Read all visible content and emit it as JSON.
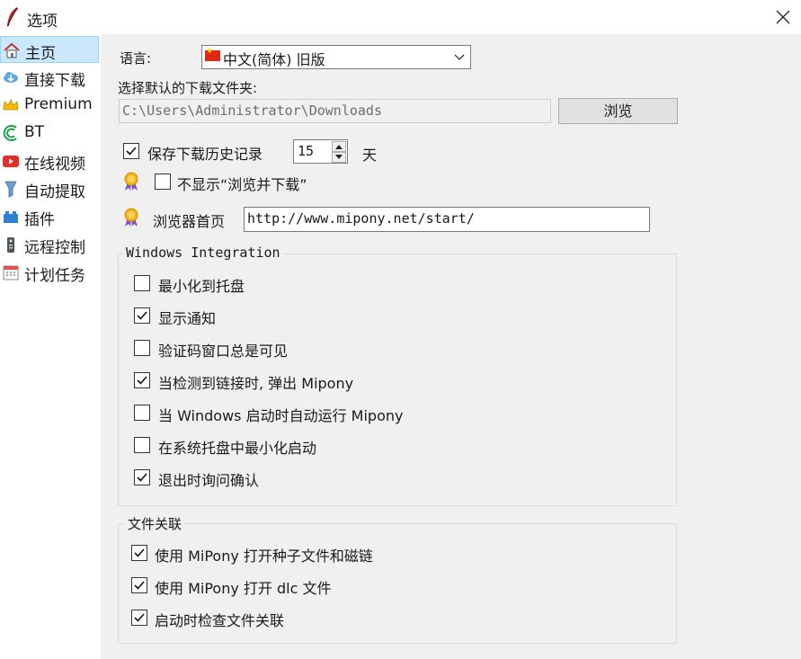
{
  "window": {
    "title": "选项"
  },
  "sidebar": {
    "items": [
      {
        "label": "主页",
        "icon": "home-icon"
      },
      {
        "label": "直接下载",
        "icon": "cloud-download-icon"
      },
      {
        "label": "Premium",
        "icon": "crown-icon"
      },
      {
        "label": "BT",
        "icon": "bittorrent-icon"
      },
      {
        "label": "在线视频",
        "icon": "youtube-icon"
      },
      {
        "label": "自动提取",
        "icon": "funnel-icon"
      },
      {
        "label": "插件",
        "icon": "plugin-icon"
      },
      {
        "label": "远程控制",
        "icon": "remote-icon"
      },
      {
        "label": "计划任务",
        "icon": "calendar-icon"
      }
    ],
    "selected": "主页"
  },
  "general": {
    "language_label": "语言:",
    "language_value": "中文(简体) 旧版",
    "folder_label": "选择默认的下载文件夹:",
    "folder_value": "C:\\Users\\Administrator\\Downloads",
    "browse_label": "浏览",
    "history_label": "保存下载历史记录",
    "history_checked": true,
    "history_days": "15",
    "days_unit": "天",
    "hide_browse_label": "不显示“浏览并下载”",
    "hide_browse_checked": false,
    "homepage_label": "浏览器首页",
    "homepage_value": "http://www.mipony.net/start/"
  },
  "windows_integration": {
    "legend": "Windows Integration",
    "options": [
      {
        "label": "最小化到托盘",
        "checked": false
      },
      {
        "label": "显示通知",
        "checked": true
      },
      {
        "label": "验证码窗口总是可见",
        "checked": false
      },
      {
        "label": "当检测到链接时, 弹出 Mipony",
        "checked": true
      },
      {
        "label": "当 Windows 启动时自动运行 Mipony",
        "checked": false
      },
      {
        "label": "在系统托盘中最小化启动",
        "checked": false
      },
      {
        "label": "退出时询问确认",
        "checked": true
      }
    ]
  },
  "file_association": {
    "legend": "文件关联",
    "options": [
      {
        "label": "使用 MiPony 打开种子文件和磁链",
        "checked": true
      },
      {
        "label": "使用 MiPony 打开 dlc 文件",
        "checked": true
      },
      {
        "label": "启动时检查文件关联",
        "checked": true
      }
    ]
  }
}
